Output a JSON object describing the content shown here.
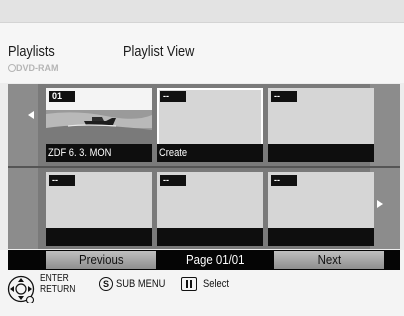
{
  "header": {
    "title": "Playlists",
    "view_title": "Playlist View",
    "disc_label": "DVD-RAM"
  },
  "tiles": [
    {
      "tag": "01",
      "label": "ZDF   6. 3. MON",
      "has_thumbnail": true,
      "selected": false
    },
    {
      "tag": "--",
      "label": "Create",
      "has_thumbnail": false,
      "selected": true
    },
    {
      "tag": "--",
      "label": "",
      "has_thumbnail": false,
      "selected": false
    },
    {
      "tag": "--",
      "label": "",
      "has_thumbnail": false,
      "selected": false
    },
    {
      "tag": "--",
      "label": "",
      "has_thumbnail": false,
      "selected": false
    },
    {
      "tag": "--",
      "label": "",
      "has_thumbnail": false,
      "selected": false
    }
  ],
  "pager": {
    "previous_label": "Previous",
    "page_info": "Page 01/01",
    "next_label": "Next"
  },
  "hints": {
    "enter_label": "ENTER",
    "return_label": "RETURN",
    "submenu_key": "S",
    "submenu_label": "SUB MENU",
    "select_label": "Select",
    "icons": [
      "dpad-icon",
      "circle-s-icon",
      "pause-icon"
    ]
  },
  "colors": {
    "background": "#ededed",
    "grid": "#7a7a7a",
    "tile": "#d6d6d6",
    "label_bar": "#0e0e0e",
    "button": "#a8a8a8"
  }
}
